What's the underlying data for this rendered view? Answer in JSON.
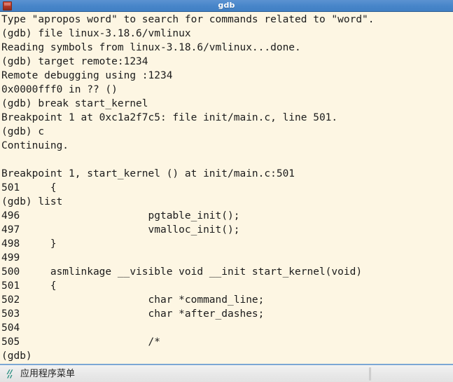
{
  "window": {
    "title": "gdb",
    "icon": "terminal-app-icon",
    "titlebar_color": "#4785c9",
    "title_text_color": "#ffffff"
  },
  "terminal": {
    "background_color": "#fdf6e3",
    "foreground_color": "#1b1b1b",
    "lines": [
      "Type \"apropos word\" to search for commands related to \"word\".",
      "(gdb) file linux-3.18.6/vmlinux",
      "Reading symbols from linux-3.18.6/vmlinux...done.",
      "(gdb) target remote:1234",
      "Remote debugging using :1234",
      "0x0000fff0 in ?? ()",
      "(gdb) break start_kernel",
      "Breakpoint 1 at 0xc1a2f7c5: file init/main.c, line 501.",
      "(gdb) c",
      "Continuing.",
      "",
      "Breakpoint 1, start_kernel () at init/main.c:501",
      "501     {",
      "(gdb) list",
      "496                     pgtable_init();",
      "497                     vmalloc_init();",
      "498     }",
      "499",
      "500     asmlinkage __visible void __init start_kernel(void)",
      "501     {",
      "502                     char *command_line;",
      "503                     char *after_dashes;",
      "504",
      "505                     /*",
      "(gdb)"
    ]
  },
  "taskbar": {
    "background_color": "#e9e9e9",
    "accent_color": "#7ba7d4",
    "menu_icon": "xfce-applications-menu-icon",
    "menu_icon_color": "#2e9183",
    "menu_label": "应用程序菜单"
  }
}
